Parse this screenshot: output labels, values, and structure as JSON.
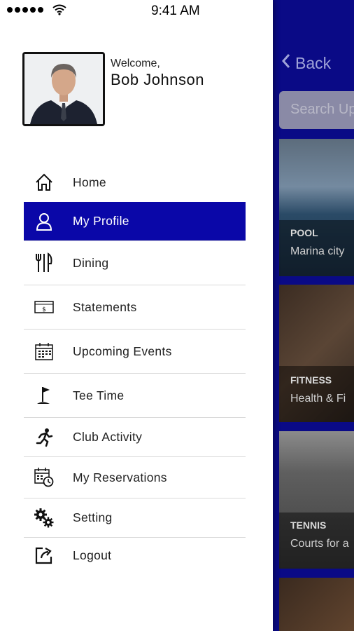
{
  "status_bar": {
    "time": "9:41 AM"
  },
  "user": {
    "welcome": "Welcome,",
    "name": "Bob Johnson"
  },
  "menu": [
    {
      "label": "Home",
      "icon": "home-icon",
      "active": false
    },
    {
      "label": "My Profile",
      "icon": "person-icon",
      "active": true
    },
    {
      "label": "Dining",
      "icon": "dining-icon",
      "active": false
    },
    {
      "label": "Statements",
      "icon": "dollar-bill-icon",
      "active": false
    },
    {
      "label": "Upcoming Events",
      "icon": "calendar-icon",
      "active": false
    },
    {
      "label": "Tee Time",
      "icon": "golf-flag-icon",
      "active": false
    },
    {
      "label": "Club Activity",
      "icon": "running-icon",
      "active": false
    },
    {
      "label": "My Reservations",
      "icon": "calendar-clock-icon",
      "active": false
    },
    {
      "label": "Setting",
      "icon": "gears-icon",
      "active": false
    },
    {
      "label": "Logout",
      "icon": "logout-icon",
      "active": false
    }
  ],
  "background": {
    "back_label": "Back",
    "search_placeholder": "Search Up",
    "cards": [
      {
        "category": "POOL",
        "subtitle": "Marina city"
      },
      {
        "category": "FITNESS",
        "subtitle": "Health & Fi"
      },
      {
        "category": "TENNIS",
        "subtitle": "Courts for a"
      }
    ]
  },
  "colors": {
    "accent": "#0a07a8",
    "background_app": "#0a0a86"
  }
}
